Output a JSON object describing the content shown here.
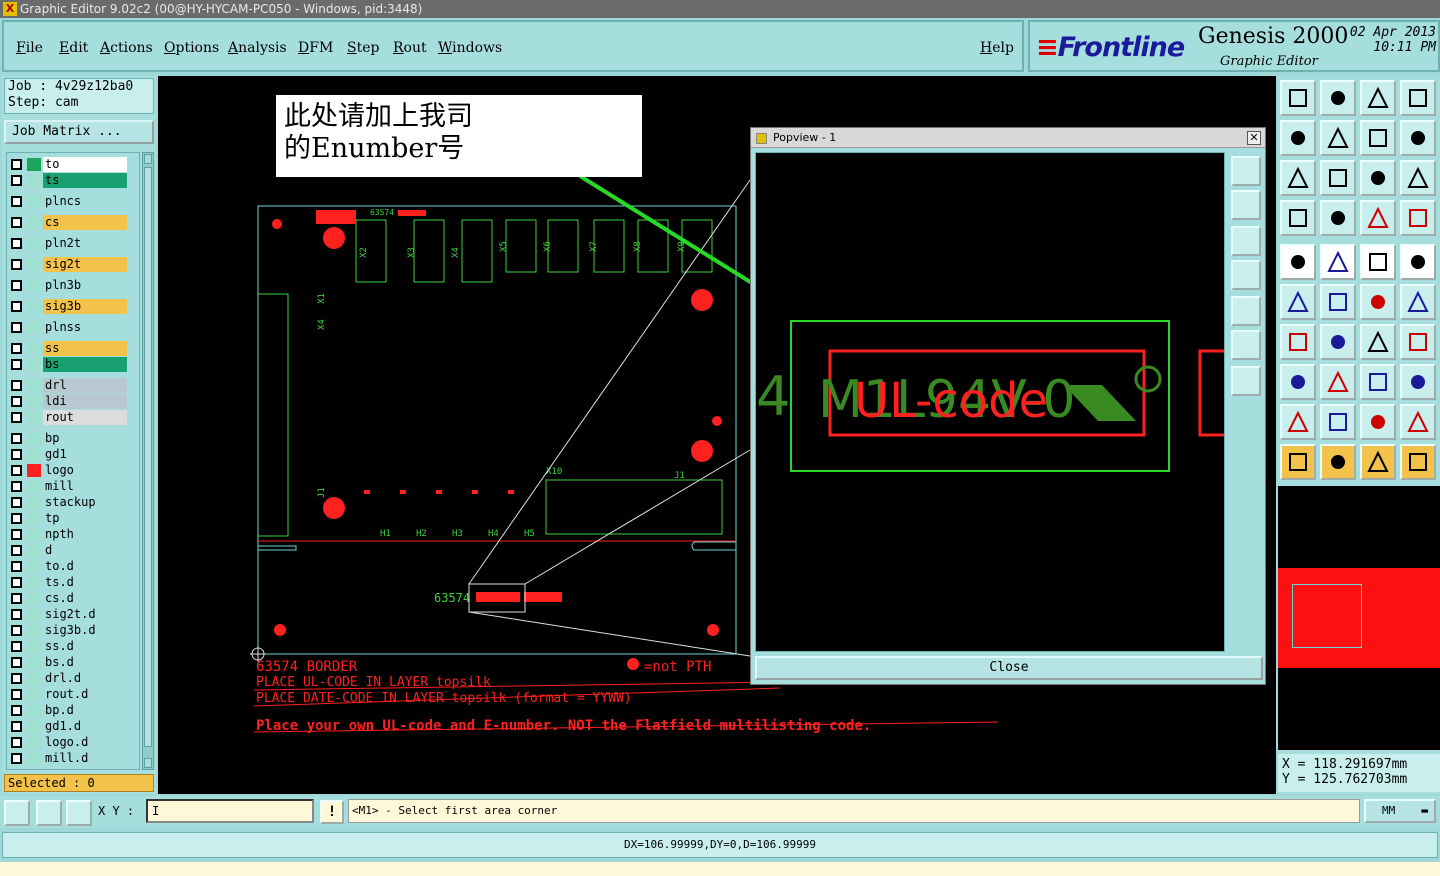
{
  "window": {
    "title": "Graphic Editor 9.02c2 (00@HY-HYCAM-PC050 - Windows, pid:3448)"
  },
  "menu": {
    "items": [
      "File",
      "Edit",
      "Actions",
      "Options",
      "Analysis",
      "DFM",
      "Step",
      "Rout",
      "Windows"
    ],
    "help": "Help"
  },
  "brand": {
    "logo": "Frontline",
    "product": "Genesis 2000",
    "subtitle": "Graphic Editor",
    "date": "02 Apr 2013",
    "time": "10:11 PM"
  },
  "job": {
    "job_line": "Job  : 4v29z12ba0",
    "step_line": "Step: cam",
    "matrix_button": "Job Matrix ..."
  },
  "layers": [
    {
      "name": "to",
      "swatch": "#1aa55a",
      "color": "#ffffff"
    },
    {
      "name": "ts",
      "swatch": "#a0e0d0",
      "color": "#18a070"
    },
    {
      "name": "plncs",
      "swatch": "#a0e0d0",
      "color": "#a6dede"
    },
    {
      "name": "cs",
      "swatch": "#a0e0d0",
      "color": "#f2c24a"
    },
    {
      "name": "pln2t",
      "swatch": "#a0e0d0",
      "color": "#a6dede"
    },
    {
      "name": "sig2t",
      "swatch": "#a0e0d0",
      "color": "#f2c24a"
    },
    {
      "name": "pln3b",
      "swatch": "#a0e0d0",
      "color": "#a6dede"
    },
    {
      "name": "sig3b",
      "swatch": "#a0e0d0",
      "color": "#f2c24a"
    },
    {
      "name": "plnss",
      "swatch": "#a0e0d0",
      "color": "#a6dede"
    },
    {
      "name": "ss",
      "swatch": "#a0e0d0",
      "color": "#f2c24a"
    },
    {
      "name": "bs",
      "swatch": "#a0e0d0",
      "color": "#18a070"
    },
    {
      "name": "drl",
      "swatch": "#a0e0d0",
      "color": "#b8c8d0"
    },
    {
      "name": "ldi",
      "swatch": "#a0e0d0",
      "color": "#b8c8d0"
    },
    {
      "name": "rout",
      "swatch": "#a0e0d0",
      "color": "#dcdcdc"
    },
    {
      "name": "bp",
      "swatch": "#a0e0d0",
      "color": "#a6dede"
    },
    {
      "name": "gd1",
      "swatch": "#a0e0d0",
      "color": "#a6dede"
    },
    {
      "name": "logo",
      "swatch": "#ff2020",
      "color": "#a6dede"
    },
    {
      "name": "mill",
      "swatch": "#a0e0d0",
      "color": "#a6dede"
    },
    {
      "name": "stackup",
      "swatch": "#a0e0d0",
      "color": "#a6dede"
    },
    {
      "name": "tp",
      "swatch": "#a0e0d0",
      "color": "#a6dede"
    },
    {
      "name": "npth",
      "swatch": "#a0e0d0",
      "color": "#a6dede"
    },
    {
      "name": "d",
      "swatch": "#a0e0d0",
      "color": "#a6dede"
    },
    {
      "name": "to.d",
      "swatch": "#a0e0d0",
      "color": "#a6dede"
    },
    {
      "name": "ts.d",
      "swatch": "#a0e0d0",
      "color": "#a6dede"
    },
    {
      "name": "cs.d",
      "swatch": "#a0e0d0",
      "color": "#a6dede"
    },
    {
      "name": "sig2t.d",
      "swatch": "#a0e0d0",
      "color": "#a6dede"
    },
    {
      "name": "sig3b.d",
      "swatch": "#a0e0d0",
      "color": "#a6dede"
    },
    {
      "name": "ss.d",
      "swatch": "#a0e0d0",
      "color": "#a6dede"
    },
    {
      "name": "bs.d",
      "swatch": "#a0e0d0",
      "color": "#a6dede"
    },
    {
      "name": "drl.d",
      "swatch": "#a0e0d0",
      "color": "#a6dede"
    },
    {
      "name": "rout.d",
      "swatch": "#a0e0d0",
      "color": "#a6dede"
    },
    {
      "name": "bp.d",
      "swatch": "#a0e0d0",
      "color": "#a6dede"
    },
    {
      "name": "gd1.d",
      "swatch": "#a0e0d0",
      "color": "#a6dede"
    },
    {
      "name": "logo.d",
      "swatch": "#a0e0d0",
      "color": "#a6dede"
    },
    {
      "name": "mill.d",
      "swatch": "#a0e0d0",
      "color": "#a6dede"
    }
  ],
  "selected": "Selected : 0",
  "canvas": {
    "note_line1": "此处请加上我司",
    "note_line2": "的Enumber号",
    "part_numbers": [
      "63574",
      "63574",
      "63574"
    ],
    "connector_labels": [
      "X2",
      "X3",
      "X4",
      "X5",
      "X6",
      "X7",
      "X8",
      "X9"
    ],
    "ref_labels": [
      "X1",
      "X4",
      "J1",
      "X10",
      "J1",
      "H1",
      "H2",
      "H3",
      "H4",
      "H5"
    ],
    "text_border": "63574  BORDER",
    "text_legend": "=not PTH",
    "text_ul": "PLACE UL-CODE IN LAYER topsilk",
    "text_date": "PLACE DATE-CODE IN LAYER topsilk (format = YYWW)",
    "text_instruction": "Place your own UL-code and E-number. NOT the Flatfield multilisting code."
  },
  "popview": {
    "title": "Popview - 1",
    "close_label": "Close",
    "text_green": "M1L94V-0",
    "text_red": "UL-code",
    "text_edge": "4"
  },
  "coords": {
    "x_line": "X  =  118.291697mm",
    "y_line": "Y  =  125.762703mm"
  },
  "bottom": {
    "xy_label": "X Y :",
    "xy_value": "I",
    "excl": "!",
    "prompt": "<M1> - Select first area corner",
    "units": "MM",
    "status": "DX=106.99999,DY=0,D=106.99999"
  },
  "colors": {
    "panel": "#a6dede",
    "canvas": "#000000",
    "green": "#3cd23c",
    "red": "#ff2020",
    "cyan": "#6ad6d6"
  }
}
